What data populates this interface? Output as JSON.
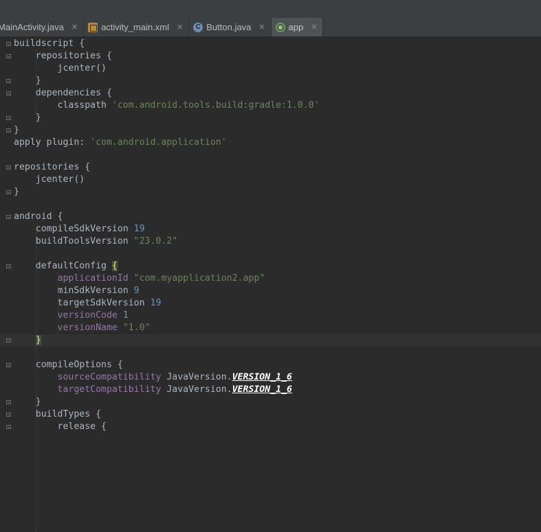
{
  "tabs": [
    {
      "label": "MainActivity.java",
      "icon": "java-file-icon",
      "active": false
    },
    {
      "label": "activity_main.xml",
      "icon": "xml-file-icon",
      "active": false
    },
    {
      "label": "Button.java",
      "icon": "class-icon",
      "active": false
    },
    {
      "label": "app",
      "icon": "gradle-icon",
      "active": true
    }
  ],
  "code_lines": [
    [
      {
        "t": "buildscript {",
        "c": "kw"
      }
    ],
    [
      {
        "t": "    repositories {",
        "c": "kw"
      }
    ],
    [
      {
        "t": "        jcenter()",
        "c": "kw"
      }
    ],
    [
      {
        "t": "    }",
        "c": "kw"
      }
    ],
    [
      {
        "t": "    dependencies {",
        "c": "kw"
      }
    ],
    [
      {
        "t": "        classpath ",
        "c": "kw"
      },
      {
        "t": "'com.android.tools.build:gradle:1.0.0'",
        "c": "str"
      }
    ],
    [
      {
        "t": "    }",
        "c": "kw"
      }
    ],
    [
      {
        "t": "}",
        "c": "kw"
      }
    ],
    [
      {
        "t": "apply plugin: ",
        "c": "kw"
      },
      {
        "t": "'com.android.application'",
        "c": "str"
      }
    ],
    [],
    [
      {
        "t": "repositories {",
        "c": "kw"
      }
    ],
    [
      {
        "t": "    jcenter()",
        "c": "kw"
      }
    ],
    [
      {
        "t": "}",
        "c": "kw"
      }
    ],
    [],
    [
      {
        "t": "android {",
        "c": "kw"
      }
    ],
    [
      {
        "t": "    compileSdkVersion ",
        "c": "kw"
      },
      {
        "t": "19",
        "c": "num"
      }
    ],
    [
      {
        "t": "    buildToolsVersion ",
        "c": "kw"
      },
      {
        "t": "\"23.0.2\"",
        "c": "str"
      }
    ],
    [],
    [
      {
        "t": "    defaultConfig ",
        "c": "kw"
      },
      {
        "t": "{",
        "c": "brace-hl"
      }
    ],
    [
      {
        "t": "        ",
        "c": "kw"
      },
      {
        "t": "applicationId",
        "c": "prop"
      },
      {
        "t": " ",
        "c": "kw"
      },
      {
        "t": "\"com.myapplication2.app\"",
        "c": "str"
      }
    ],
    [
      {
        "t": "        minSdkVersion ",
        "c": "kw"
      },
      {
        "t": "9",
        "c": "num"
      }
    ],
    [
      {
        "t": "        targetSdkVersion ",
        "c": "kw"
      },
      {
        "t": "19",
        "c": "num"
      }
    ],
    [
      {
        "t": "        ",
        "c": "kw"
      },
      {
        "t": "versionCode",
        "c": "prop"
      },
      {
        "t": " ",
        "c": "kw"
      },
      {
        "t": "1",
        "c": "num"
      }
    ],
    [
      {
        "t": "        ",
        "c": "kw"
      },
      {
        "t": "versionName",
        "c": "prop"
      },
      {
        "t": " ",
        "c": "kw"
      },
      {
        "t": "\"1.0\"",
        "c": "str"
      }
    ],
    [
      {
        "t": "    ",
        "c": "kw"
      },
      {
        "t": "}",
        "c": "brace-hl"
      }
    ],
    [],
    [
      {
        "t": "    compileOptions {",
        "c": "kw"
      }
    ],
    [
      {
        "t": "        ",
        "c": "kw"
      },
      {
        "t": "sourceCompatibility",
        "c": "prop"
      },
      {
        "t": " JavaVersion.",
        "c": "kw"
      },
      {
        "t": "VERSION_1_6",
        "c": "field"
      }
    ],
    [
      {
        "t": "        ",
        "c": "kw"
      },
      {
        "t": "targetCompatibility",
        "c": "prop"
      },
      {
        "t": " JavaVersion.",
        "c": "kw"
      },
      {
        "t": "VERSION_1_6",
        "c": "field"
      }
    ],
    [
      {
        "t": "    }",
        "c": "kw"
      }
    ],
    [
      {
        "t": "    buildTypes {",
        "c": "kw"
      }
    ],
    [
      {
        "t": "        release {",
        "c": "kw"
      }
    ]
  ],
  "fold_lines": [
    0,
    1,
    3,
    4,
    6,
    7,
    10,
    12,
    14,
    18,
    24,
    26,
    29,
    30,
    31
  ],
  "current_line": 24
}
